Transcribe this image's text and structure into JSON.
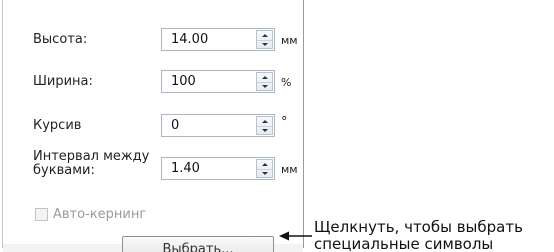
{
  "dialog": {
    "rows": [
      {
        "label": "Высота:",
        "value": "14.00",
        "unit": "мм"
      },
      {
        "label": "Ширина:",
        "value": "100",
        "unit": "%"
      },
      {
        "label": "Курсив",
        "value": "0",
        "unit": "°"
      },
      {
        "label": "Интервал между буквами:",
        "value": "1.40",
        "unit": "мм"
      }
    ],
    "kerning_label": "Авто-кернинг",
    "kerning_checked": false,
    "special_button_label": "Выбрать..."
  },
  "callout": {
    "line1": "Щелкнуть, чтобы выбрать",
    "line2": "специальные символы"
  },
  "icons": {
    "spinner_up": "spinner-up-icon",
    "spinner_down": "spinner-down-icon",
    "callout_arrow": "arrow-left-icon"
  }
}
